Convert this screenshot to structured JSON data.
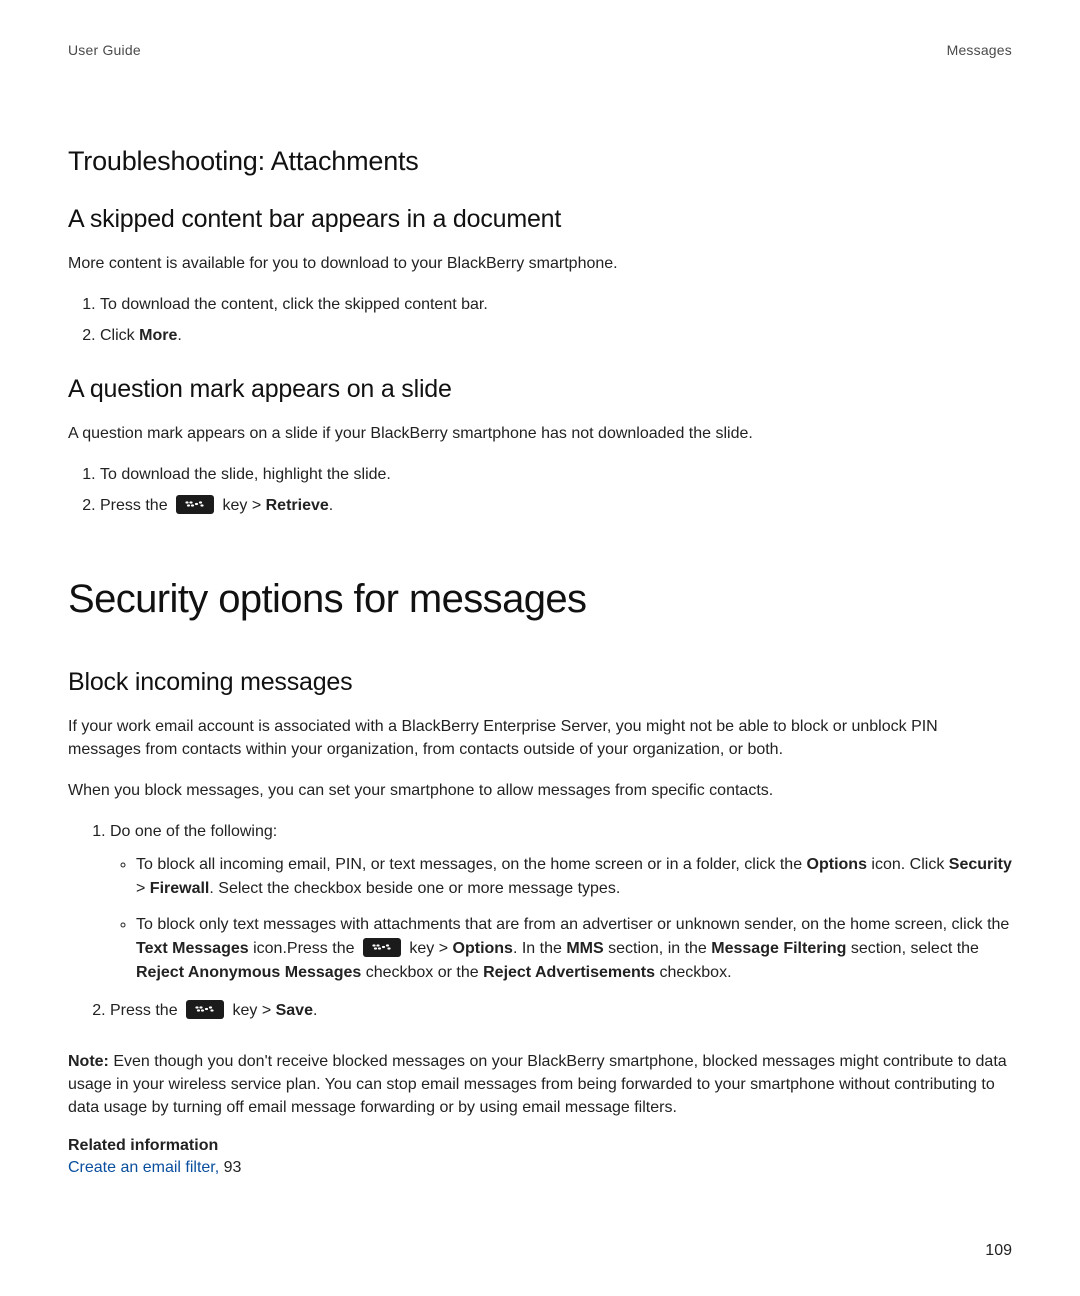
{
  "header": {
    "left": "User Guide",
    "right": "Messages"
  },
  "h_trouble": "Troubleshooting: Attachments",
  "h_skip": "A skipped content bar appears in a document",
  "p_skip": "More content is available for you to download to your BlackBerry smartphone.",
  "skip_steps": {
    "s1": "To download the content, click the skipped content bar.",
    "s2a": "Click ",
    "s2b": "More",
    "s2c": "."
  },
  "h_q": "A question mark appears on a slide",
  "p_q": "A question mark appears on a slide if your BlackBerry smartphone has not downloaded the slide.",
  "q_steps": {
    "s1": "To download the slide, highlight the slide.",
    "s2a": "Press the ",
    "s2b": " key > ",
    "s2c": "Retrieve",
    "s2d": "."
  },
  "h_sec": "Security options for messages",
  "h_block": "Block incoming messages",
  "p_block1": "If your work email account is associated with a BlackBerry Enterprise Server, you might not be able to block or unblock PIN messages from contacts within your organization, from contacts outside of your organization, or both.",
  "p_block2": "When you block messages, you can set your smartphone to allow messages from specific contacts.",
  "block_steps": {
    "s1": "Do one of the following:",
    "b1": {
      "t1": "To block all incoming email, PIN, or text messages, on the home screen or in a folder, click the ",
      "b1": "Options",
      "t2": " icon. Click ",
      "b2": "Security",
      "t3": " > ",
      "b3": "Firewall",
      "t4": ". Select the checkbox beside one or more message types."
    },
    "b2": {
      "t1": "To block only text messages with attachments that are from an advertiser or unknown sender, on the home screen, click the ",
      "b1": "Text Messages",
      "t2": " icon.Press the ",
      "t3": " key > ",
      "b2": "Options",
      "t4": ". In the ",
      "b3": "MMS",
      "t5": " section, in the ",
      "b4": "Message Filtering",
      "t6": " section, select the ",
      "b5": "Reject Anonymous Messages",
      "t7": " checkbox or the ",
      "b6": "Reject Advertisements",
      "t8": " checkbox."
    },
    "s2a": "Press the ",
    "s2b": " key > ",
    "s2c": "Save",
    "s2d": "."
  },
  "note": {
    "label": "Note: ",
    "text": "Even though you don't receive blocked messages on your BlackBerry smartphone, blocked messages might contribute to data usage in your wireless service plan. You can stop email messages from being forwarded to your smartphone without contributing to data usage by turning off email message forwarding or by using email message filters."
  },
  "related": {
    "title": "Related information",
    "link_text": "Create an email filter, ",
    "link_page": "93"
  },
  "page_number": "109"
}
